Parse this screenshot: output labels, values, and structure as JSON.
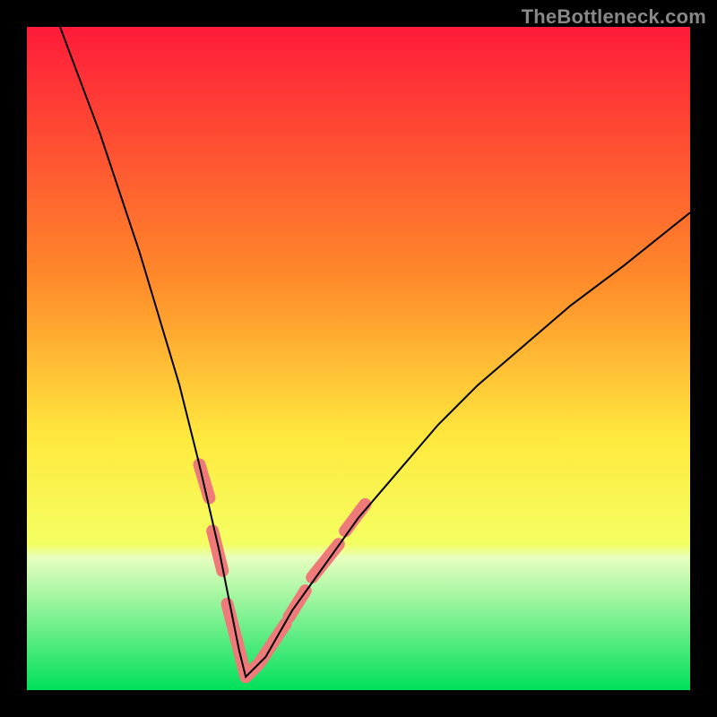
{
  "watermark": "TheBottleneck.com",
  "colors": {
    "black": "#000000",
    "curve": "#000000",
    "coral": "#ef7a7a",
    "grad_top": "#ff1b3a",
    "grad_mid_upper": "#ff8a2a",
    "grad_mid": "#ffe93e",
    "grad_lower": "#f4ff62",
    "grad_green_strip_top": "#e7ffbe",
    "grad_green_base": "#00e05a"
  },
  "chart_data": {
    "type": "line",
    "title": "",
    "xlabel": "",
    "ylabel": "",
    "xlim": [
      0,
      100
    ],
    "ylim": [
      0,
      100
    ],
    "notes": "V-shaped bottleneck curve on a vertical red→orange→yellow→green gradient; minimum near x≈33 touching the bottom green band. Pink segments highlight portions of the curve in the lower yellow region.",
    "series": [
      {
        "name": "curve",
        "x": [
          5,
          8,
          11,
          14,
          17,
          20,
          23,
          26,
          29,
          32,
          33,
          36,
          40,
          45,
          50,
          56,
          62,
          68,
          75,
          82,
          90,
          100
        ],
        "y": [
          100,
          92,
          84,
          75,
          66,
          56,
          46,
          34,
          21,
          6,
          2,
          5,
          12,
          19,
          26,
          33,
          40,
          46,
          52,
          58,
          64,
          72
        ]
      }
    ],
    "highlights": [
      {
        "name": "left-pink-upper",
        "x": [
          26,
          27.5
        ],
        "y": [
          34,
          29
        ]
      },
      {
        "name": "left-pink-mid",
        "x": [
          28,
          29.5
        ],
        "y": [
          24,
          18
        ]
      },
      {
        "name": "left-pink-lower",
        "x": [
          30.2,
          32
        ],
        "y": [
          13,
          6
        ]
      },
      {
        "name": "bottom-pink",
        "x": [
          32,
          33,
          35,
          37,
          39
        ],
        "y": [
          6,
          2,
          4,
          7,
          10
        ]
      },
      {
        "name": "right-pink-lower",
        "x": [
          39.5,
          42
        ],
        "y": [
          11,
          15
        ]
      },
      {
        "name": "right-pink-mid",
        "x": [
          43,
          47
        ],
        "y": [
          17,
          22
        ]
      },
      {
        "name": "right-pink-upper",
        "x": [
          48,
          51
        ],
        "y": [
          24,
          28
        ]
      }
    ],
    "gradient_stops": [
      {
        "pos": 0.0,
        "label": "red"
      },
      {
        "pos": 0.38,
        "label": "orange"
      },
      {
        "pos": 0.62,
        "label": "yellow"
      },
      {
        "pos": 0.78,
        "label": "light-yellow"
      },
      {
        "pos": 0.8,
        "label": "pale-green-strip"
      },
      {
        "pos": 1.0,
        "label": "green"
      }
    ]
  }
}
